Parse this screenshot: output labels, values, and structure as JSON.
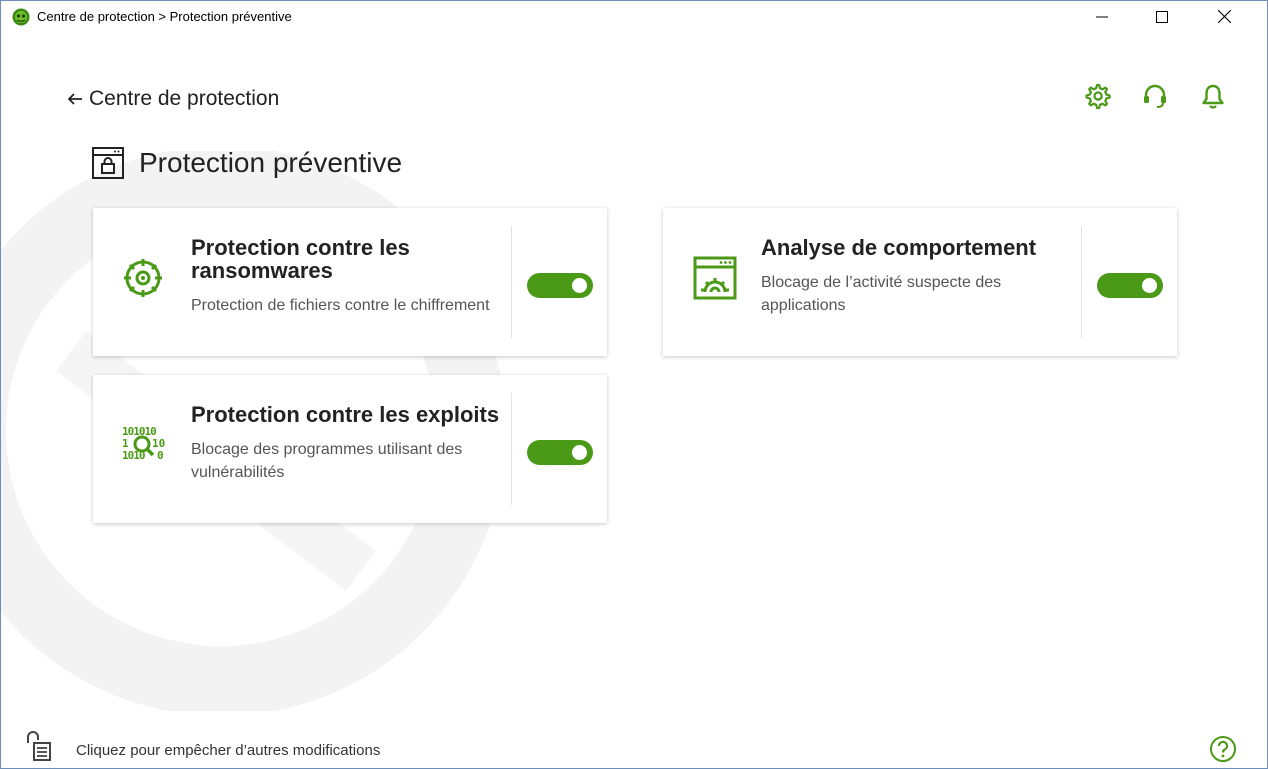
{
  "window": {
    "title": "Centre de protection > Protection préventive",
    "controls": {
      "minimize": "minimize-icon",
      "maximize": "maximize-icon",
      "close": "close-icon"
    }
  },
  "nav": {
    "back_label": "Centre de protection",
    "back_icon": "arrow-left-icon"
  },
  "top_icons": [
    "gear-icon",
    "headset-icon",
    "bell-icon"
  ],
  "page": {
    "title": "Protection préventive",
    "icon": "shield-window-icon"
  },
  "cards": [
    {
      "title": "Protection contre les ransomwares",
      "description": "Protection de fichiers contre le chiffrement",
      "icon": "ransomware-shield-icon",
      "enabled": true
    },
    {
      "title": "Analyse de comportement",
      "description": "Blocage de l’activité suspecte des applications",
      "icon": "behavior-window-icon",
      "enabled": true
    },
    {
      "title": "Protection contre les exploits",
      "description": "Blocage des programmes utilisant des vulnérabilités",
      "icon": "binary-magnifier-icon",
      "enabled": true
    }
  ],
  "footer": {
    "lock_text": "Cliquez pour empêcher d’autres modifications",
    "help_icon": "help-icon"
  },
  "colors": {
    "accent": "#4b9a17",
    "text": "#222222",
    "muted": "#555555"
  }
}
